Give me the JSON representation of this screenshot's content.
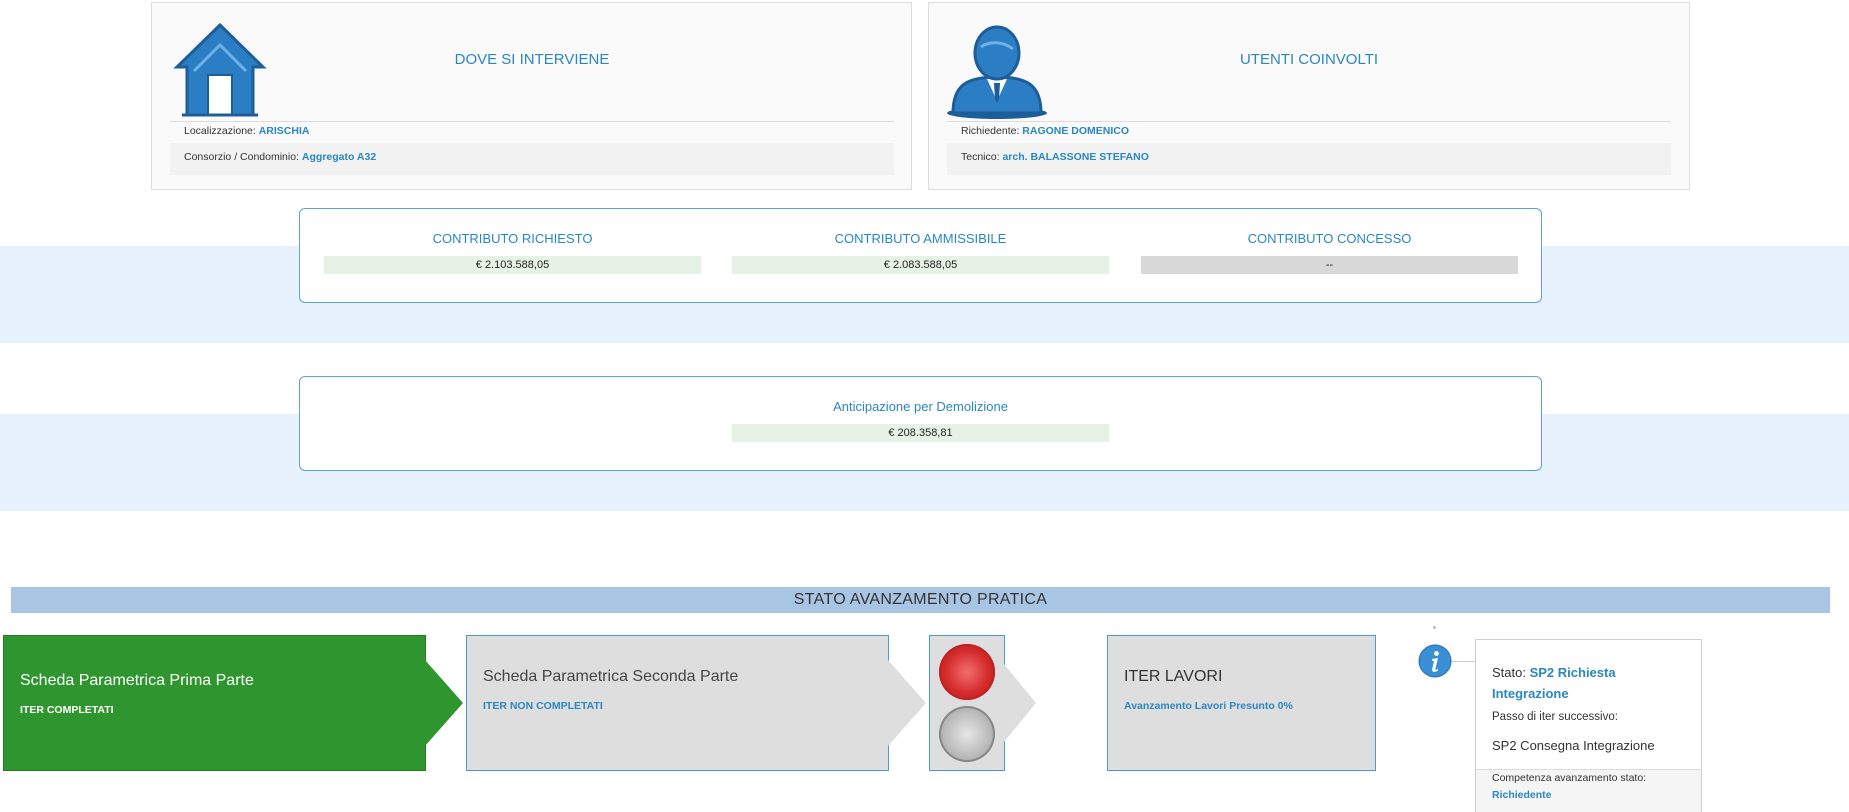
{
  "dove": {
    "title": "DOVE SI INTERVIENE",
    "icon": "house-icon",
    "localizzazione_label": "Localizzazione:",
    "localizzazione_value": "ARISCHIA",
    "consorzio_label": "Consorzio / Condominio:",
    "consorzio_value": "Aggregato A32"
  },
  "utenti": {
    "title": "UTENTI COINVOLTI",
    "icon": "user-icon",
    "richiedente_label": "Richiedente:",
    "richiedente_value": "RAGONE DOMENICO",
    "tecnico_label": "Tecnico:",
    "tecnico_value": "arch. BALASSONE STEFANO"
  },
  "contributi": {
    "richiesto_label": "CONTRIBUTO RICHIESTO",
    "richiesto_value": "€ 2.103.588,05",
    "ammissibile_label": "CONTRIBUTO AMMISSIBILE",
    "ammissibile_value": "€ 2.083.588,05",
    "concesso_label": "CONTRIBUTO CONCESSO",
    "concesso_value": "--"
  },
  "anticipazione": {
    "label": "Anticipazione per Demolizione",
    "value": "€ 208.358,81"
  },
  "stato": {
    "title": "STATO AVANZAMENTO PRATICA",
    "step1_title": "Scheda Parametrica Prima Parte",
    "step1_sub": "ITER COMPLETATI",
    "step2_title": "Scheda Parametrica Seconda Parte",
    "step2_sub": "ITER NON COMPLETATI",
    "step3_title": "ITER LAVORI",
    "step3_sub": "Avanzamento Lavori Presunto 0%",
    "traffic_light": {
      "top": "red",
      "bottom": "gray"
    }
  },
  "info": {
    "icon": "info-icon",
    "stato_label": "Stato:",
    "stato_value_line1": "SP2 Richiesta",
    "stato_value_line2": "Integrazione",
    "passo_label": "Passo di iter successivo:",
    "passo_value": "SP2 Consegna Integrazione",
    "competenza_label": "Competenza avanzamento stato:",
    "competenza_value": "Richiedente"
  },
  "colors": {
    "accent": "#2b87c1",
    "green": "#2f962f",
    "band": "#e8f2fc",
    "header_bar": "#a9c5e4"
  }
}
